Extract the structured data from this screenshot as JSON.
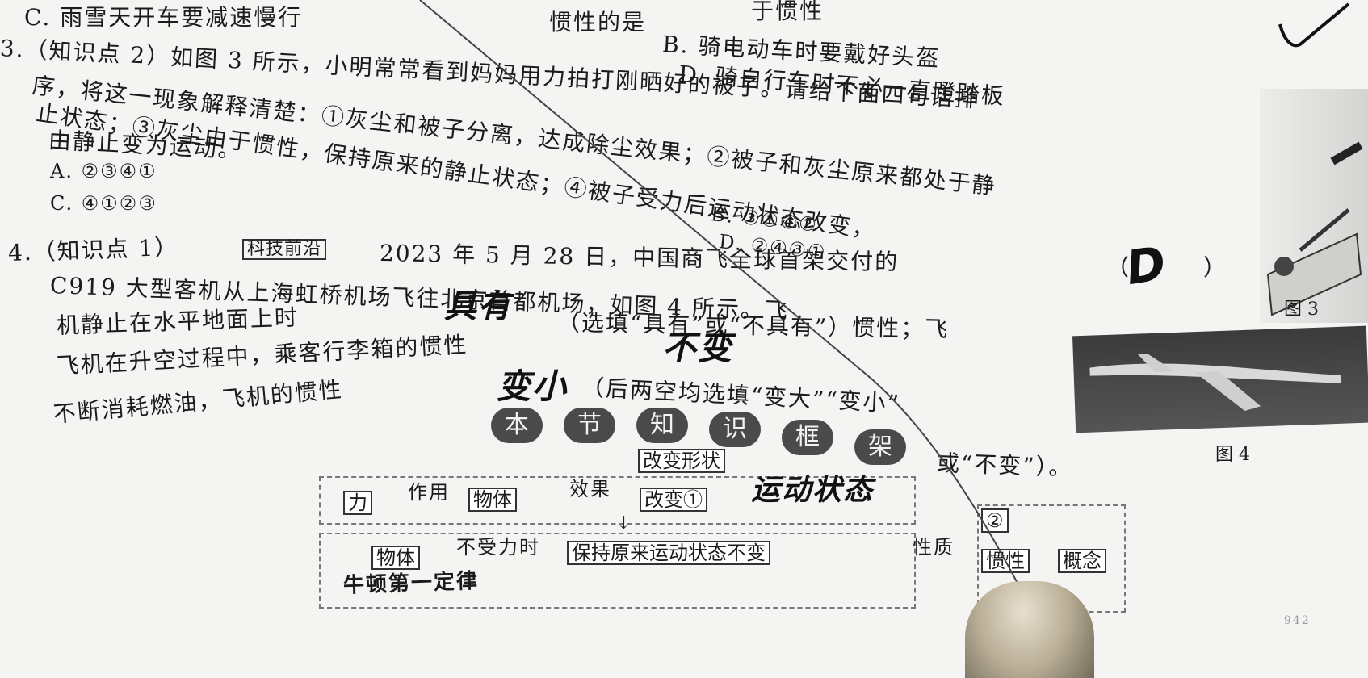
{
  "q_prev": {
    "opt_c": "C. 雨雪天开车要减速慢行",
    "opt_b": "B. 骑电动车时要戴好头盔",
    "opt_d": "D. 骑自行车时不必一直蹬踏板",
    "frag_top_center": "惯性的是",
    "frag_top_right": "于惯性"
  },
  "q3": {
    "lines": [
      "3.（知识点 2）如图 3 所示，小明常常看到妈妈用力拍打刚晒好的被子。请给下面四句话排",
      "序，将这一现象解释清楚：①灰尘和被子分离，达成除尘效果；②被子和灰尘原来都处于静",
      "止状态；③灰尘由于惯性，保持原来的静止状态；④被子受力后运动状态改变，",
      "由静止变为运动。"
    ],
    "options": {
      "a": "A. ②③④①",
      "b": "B. ③①④②",
      "c": "C. ④①②③",
      "d": "D. ②④③①"
    },
    "answer_bracket": "（",
    "answer_bracket_close": "）",
    "handwritten_answer": "D",
    "figure_caption": "图 3"
  },
  "q4": {
    "prefix": "4.（知识点 1）",
    "tag": "科技前沿",
    "line1": "2023 年 5 月 28 日，中国商飞全球首架交付的",
    "line2": "C919 大型客机从上海虹桥机场飞往北京首都机场，如图 4 所示。飞",
    "line3_a": "机静止在水平地面上时",
    "line3_b": "（选填“具有”或“不具有”）惯性；飞",
    "line4_a": "飞机在升空过程中，乘客行李箱的惯性",
    "line4_b": "（后两空均选填“变大”“变小”",
    "line5_a": "不断消耗燃油，飞机的惯性",
    "line5_b": "或“不变”）。",
    "answers": {
      "a1": "具有",
      "a2": "不变",
      "a3": "变小"
    },
    "figure_caption": "图 4"
  },
  "framework": {
    "badges": [
      "本",
      "节",
      "知",
      "识",
      "框",
      "架"
    ],
    "force": "力",
    "acts_on": "作用",
    "object": "物体",
    "effect": "效果",
    "change_shape": "改变形状",
    "change_motion": "改变①",
    "handwritten_motion": "运动状态",
    "object2": "物体",
    "no_force": "不受力时",
    "keep": "保持原来运动状态不变",
    "property": "性质",
    "law": "牛顿第一定律",
    "cell_1": "②",
    "cell_2": "惯性",
    "cell_3": "概念"
  },
  "margin_mark": "942"
}
